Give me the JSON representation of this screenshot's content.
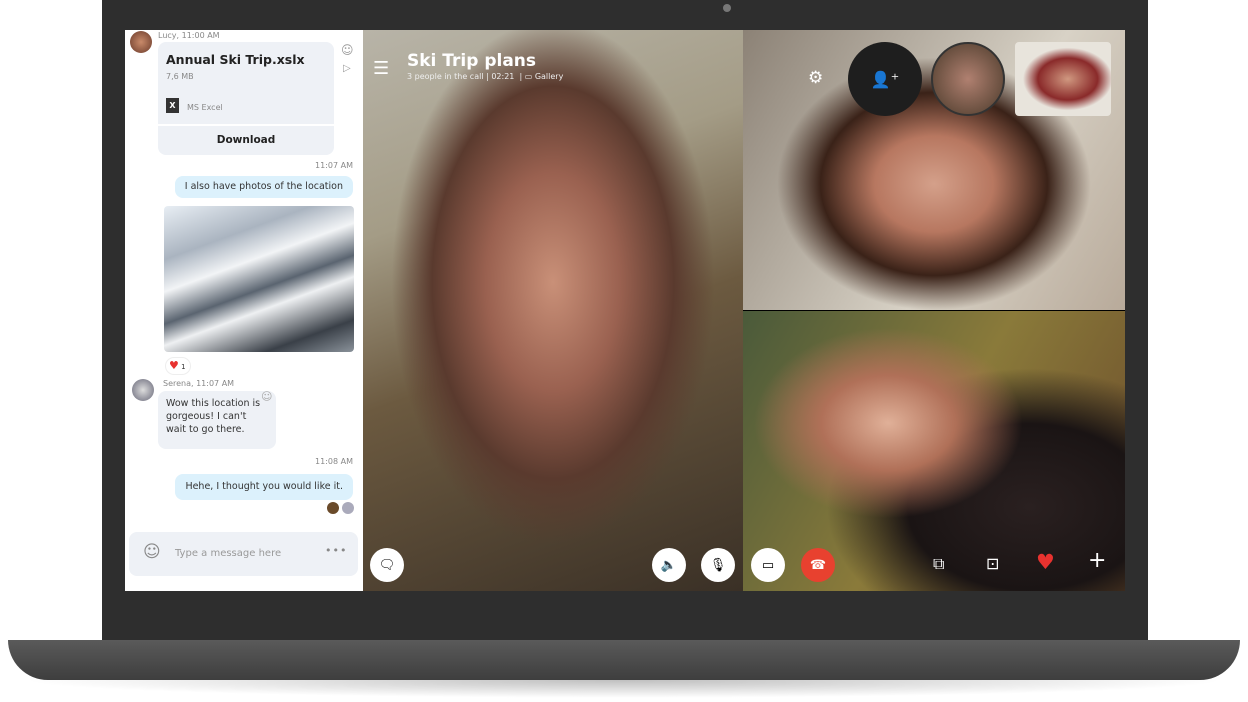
{
  "chat": {
    "messages": [
      {
        "sender_meta": "Lucy, 11:00 AM",
        "file_name": "Annual Ski Trip.xslx",
        "file_size": "7,6 MB",
        "file_type": "MS Excel",
        "download_label": "Download"
      },
      {
        "time": "11:07 AM",
        "text": "I also have photos of the location"
      },
      {
        "reaction_count": "1"
      },
      {
        "sender_meta": "Serena, 11:07 AM",
        "text": "Wow this location is gorgeous! I can't wait to go there."
      },
      {
        "time": "11:08 AM",
        "text": "Hehe, I thought you would like it."
      }
    ],
    "composer_placeholder": "Type a message here"
  },
  "call": {
    "title": "Ski Trip plans",
    "subtitle": "3 people in the call | 02:21  |",
    "view_mode": "Gallery"
  },
  "colors": {
    "end_call": "#e8412f",
    "heart": "#e8322f",
    "bubble_out": "#dcf1fc"
  }
}
